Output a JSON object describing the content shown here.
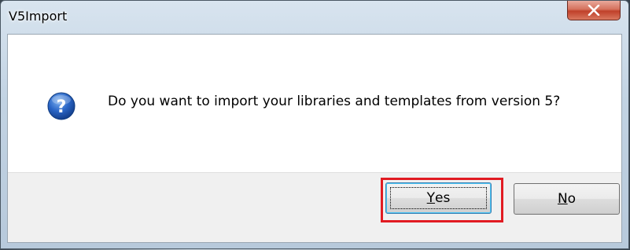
{
  "window": {
    "title": "V5Import",
    "close_icon": "close-icon"
  },
  "dialog": {
    "icon": "question-icon",
    "message": "Do you want to import your libraries and templates from version 5?"
  },
  "buttons": {
    "yes": {
      "mnemonic": "Y",
      "rest": "es"
    },
    "no": {
      "mnemonic": "N",
      "rest": "o"
    }
  },
  "annotation": {
    "highlight_color": "#e11b22"
  }
}
